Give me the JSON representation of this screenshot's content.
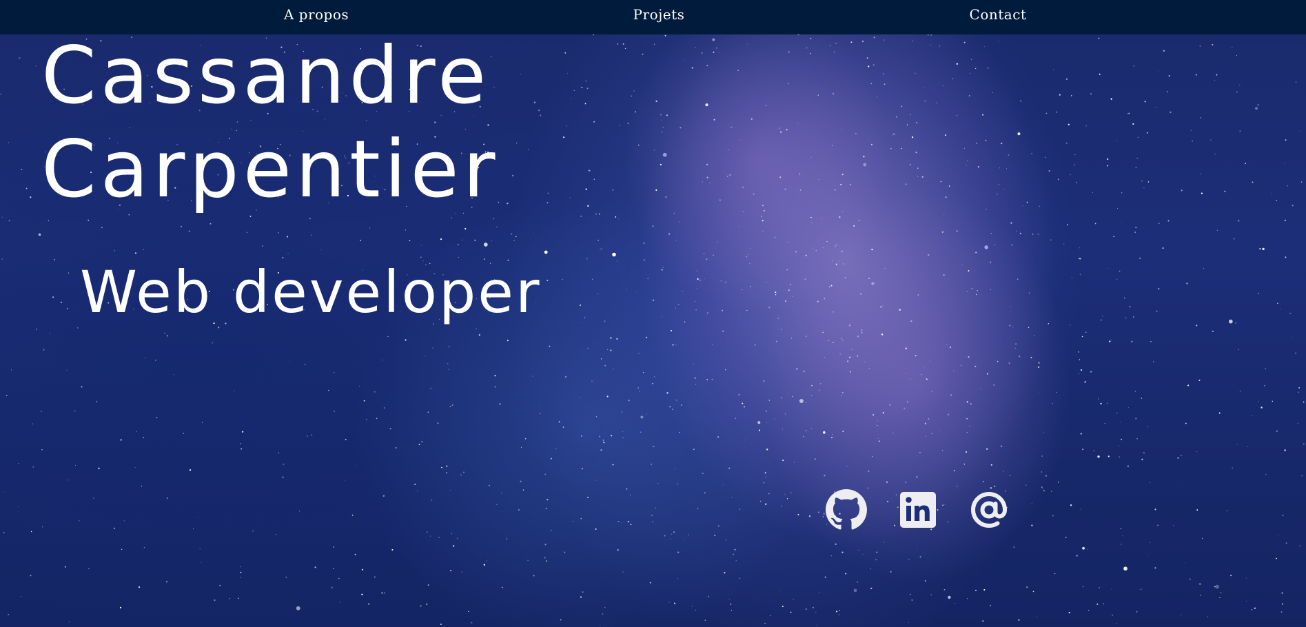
{
  "nav": {
    "items": [
      {
        "label": "A propos"
      },
      {
        "label": "Projets"
      },
      {
        "label": "Contact"
      }
    ]
  },
  "hero": {
    "name_line1": "Cassandre",
    "name_line2": "Carpentier",
    "role": "Web developer"
  },
  "social": {
    "items": [
      {
        "icon": "github-icon"
      },
      {
        "icon": "linkedin-icon"
      },
      {
        "icon": "at-sign-icon"
      }
    ]
  },
  "colors": {
    "navbar": "#001b3b",
    "text": "#ffffff",
    "icon": "#eeeef2",
    "sky": "#1c2e78",
    "nebula": "#a98cd2"
  }
}
